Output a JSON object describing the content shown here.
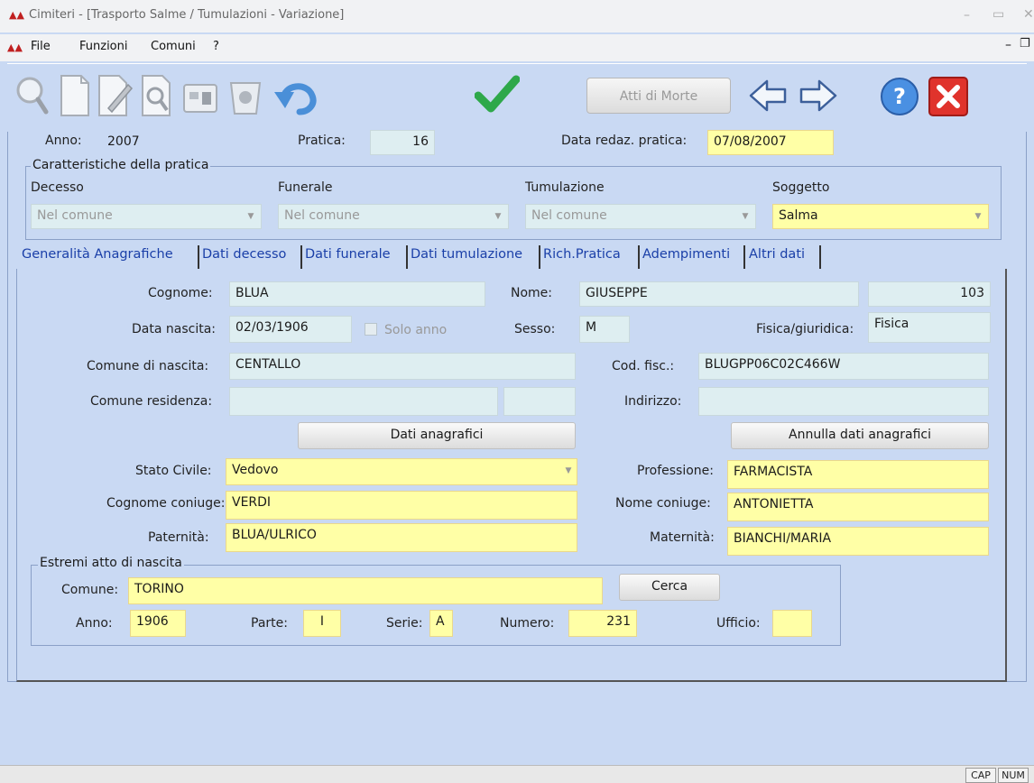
{
  "window": {
    "title": "Cimiteri - [Trasporto Salme / Tumulazioni - Variazione]",
    "app_icon": "app-logo-icon"
  },
  "menu": {
    "items": [
      "File",
      "Funzioni",
      "Comuni",
      "?"
    ]
  },
  "toolbar": {
    "atti_label": "Atti di Morte"
  },
  "header": {
    "anno_label": "Anno:",
    "anno_value": "2007",
    "pratica_label": "Pratica:",
    "pratica_value": "16",
    "data_label": "Data redaz. pratica:",
    "data_value": "07/08/2007"
  },
  "caratteristiche": {
    "title": "Caratteristiche della pratica",
    "decesso_label": "Decesso",
    "decesso_value": "Nel comune",
    "funerale_label": "Funerale",
    "funerale_value": "Nel comune",
    "tumulazione_label": "Tumulazione",
    "tumulazione_value": "Nel comune",
    "soggetto_label": "Soggetto",
    "soggetto_value": "Salma"
  },
  "tabs": [
    "Generalità Anagrafiche",
    "Dati decesso",
    "Dati funerale",
    "Dati tumulazione",
    "Rich.Pratica",
    "Adempimenti",
    "Altri dati"
  ],
  "anagrafica": {
    "cognome_label": "Cognome:",
    "cognome": "BLUA",
    "nome_label": "Nome:",
    "nome": "GIUSEPPE",
    "codice": "103",
    "data_nascita_label": "Data nascita:",
    "data_nascita": "02/03/1906",
    "solo_anno_label": "Solo anno",
    "sesso_label": "Sesso:",
    "sesso": "M",
    "fisica_label": "Fisica/giuridica:",
    "fisica": "Fisica",
    "comune_nascita_label": "Comune di nascita:",
    "comune_nascita": "CENTALLO",
    "cod_fisc_label": "Cod. fisc.:",
    "cod_fisc": "BLUGPP06C02C466W",
    "comune_residenza_label": "Comune residenza:",
    "comune_residenza": "",
    "indirizzo_label": "Indirizzo:",
    "indirizzo": "",
    "dati_anagrafici_btn": "Dati anagrafici",
    "annulla_btn": "Annulla dati anagrafici",
    "stato_civile_label": "Stato Civile:",
    "stato_civile": "Vedovo",
    "professione_label": "Professione:",
    "professione": "FARMACISTA",
    "cognome_coniuge_label": "Cognome coniuge:",
    "cognome_coniuge": "VERDI",
    "nome_coniuge_label": "Nome coniuge:",
    "nome_coniuge": "ANTONIETTA",
    "paternita_label": "Paternità:",
    "paternita": "BLUA/ULRICO",
    "maternita_label": "Maternità:",
    "maternita": "BIANCHI/MARIA"
  },
  "atto": {
    "title": "Estremi atto di nascita",
    "comune_label": "Comune:",
    "comune": "TORINO",
    "cerca_btn": "Cerca",
    "anno_label": "Anno:",
    "anno": "1906",
    "parte_label": "Parte:",
    "parte": "I",
    "serie_label": "Serie:",
    "serie": "A",
    "numero_label": "Numero:",
    "numero": "231",
    "ufficio_label": "Ufficio:",
    "ufficio": ""
  },
  "status": {
    "cap": "CAP",
    "num": "NUM"
  }
}
